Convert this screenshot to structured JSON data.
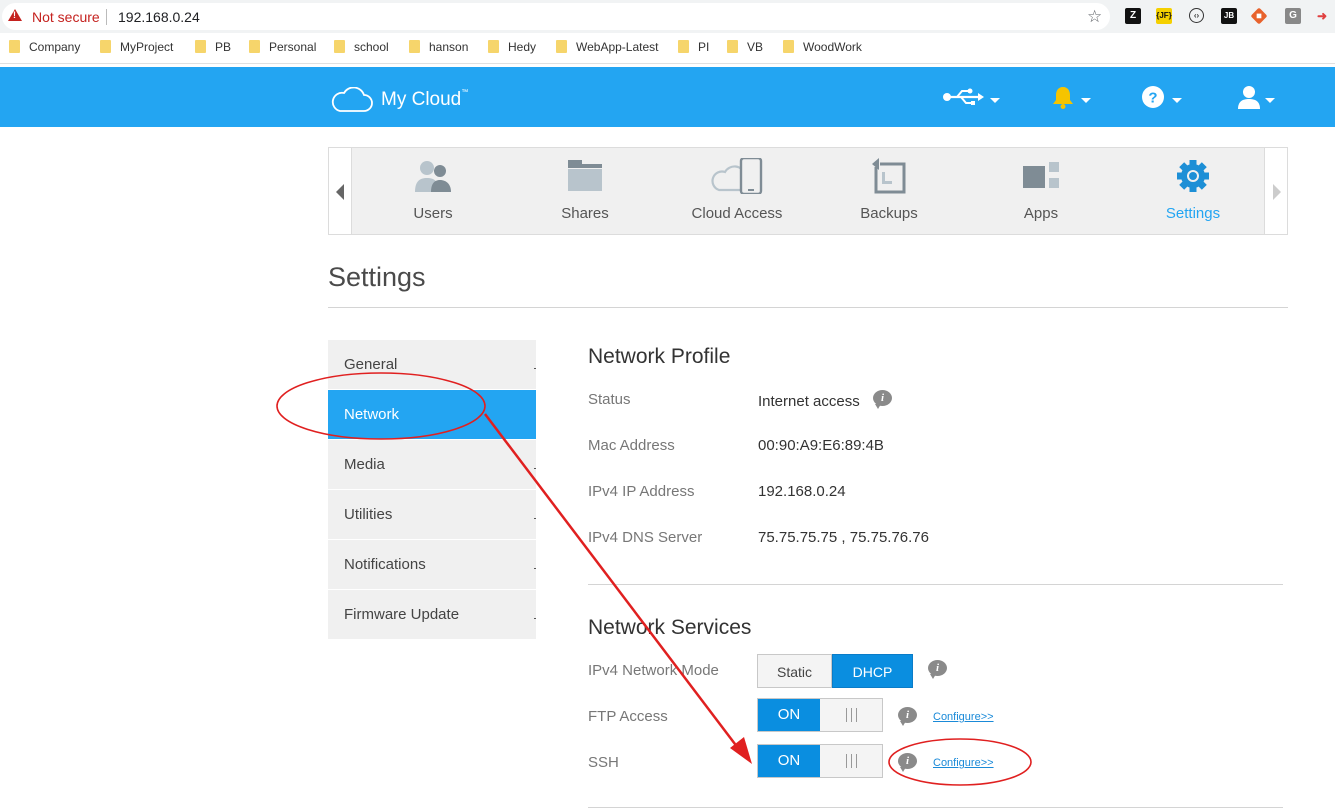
{
  "browser": {
    "security_label": "Not secure",
    "url": "192.168.0.24",
    "bookmarks": [
      "Company",
      "MyProject",
      "PB",
      "Personal",
      "school",
      "hanson",
      "Hedy",
      "WebApp-Latest",
      "PI",
      "VB",
      "WoodWork"
    ],
    "extensions": [
      "Z",
      "{JF}",
      "JB",
      "G"
    ]
  },
  "header": {
    "brand": "My Cloud",
    "trademark": "™"
  },
  "nav": {
    "items": [
      {
        "label": "Users"
      },
      {
        "label": "Shares"
      },
      {
        "label": "Cloud Access"
      },
      {
        "label": "Backups"
      },
      {
        "label": "Apps"
      },
      {
        "label": "Settings"
      }
    ],
    "active": "Settings"
  },
  "page": {
    "title": "Settings"
  },
  "sidebar": {
    "items": [
      {
        "label": "General"
      },
      {
        "label": "Network"
      },
      {
        "label": "Media"
      },
      {
        "label": "Utilities"
      },
      {
        "label": "Notifications"
      },
      {
        "label": "Firmware Update"
      }
    ],
    "active": "Network"
  },
  "profile": {
    "title": "Network Profile",
    "status_label": "Status",
    "status_value": "Internet access",
    "mac_label": "Mac Address",
    "mac_value": "00:90:A9:E6:89:4B",
    "ip_label": "IPv4 IP Address",
    "ip_value": "192.168.0.24",
    "dns_label": "IPv4 DNS Server",
    "dns_value": "75.75.75.75 , 75.75.76.76"
  },
  "services": {
    "title": "Network Services",
    "mode_label": "IPv4 Network Mode",
    "mode_options": [
      "Static",
      "DHCP"
    ],
    "mode_selected": "DHCP",
    "ftp_label": "FTP Access",
    "ftp_state": "ON",
    "ssh_label": "SSH",
    "ssh_state": "ON",
    "configure_label": "Configure>>"
  },
  "info_glyph": "i",
  "colors": {
    "brand_blue": "#23a5f2",
    "toggle_blue": "#0a8ee0",
    "annotation_red": "#e02020"
  }
}
